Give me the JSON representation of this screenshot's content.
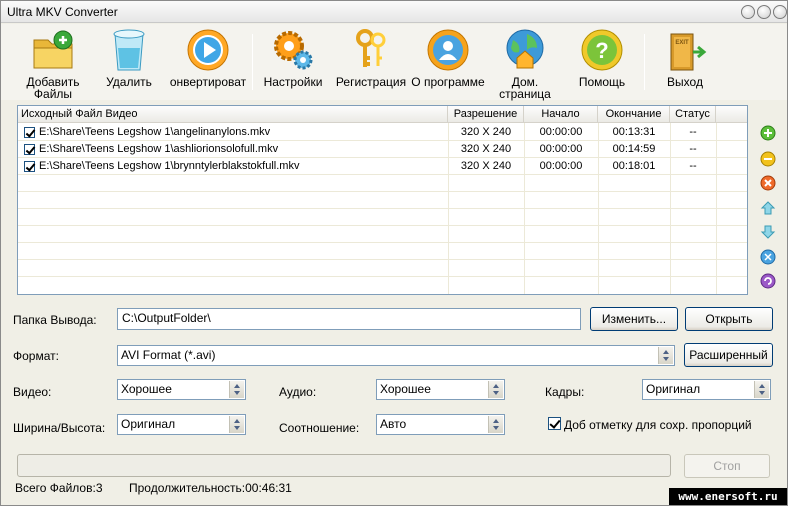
{
  "window": {
    "title": "Ultra MKV Converter"
  },
  "toolbar": {
    "add_label": "Добавить Файлы",
    "delete_label": "Удалить",
    "convert_label": "онвертироват",
    "settings_label": "Настройки",
    "register_label": "Регистрация",
    "about_label": "О программе",
    "home_label": "Дом. страница",
    "help_label": "Помощь",
    "exit_label": "Выход",
    "exit_sign": "EXIT"
  },
  "filelist": {
    "columns": [
      "Исходный Файл Видео",
      "Разрешение",
      "Начало",
      "Окончание",
      "Статус"
    ],
    "rows": [
      {
        "file": "E:\\Share\\Teens Legshow 1\\angelinanylons.mkv",
        "resolution": "320 X 240",
        "start": "00:00:00",
        "end": "00:13:31",
        "status": "--"
      },
      {
        "file": "E:\\Share\\Teens Legshow 1\\ashliorionsolofull.mkv",
        "resolution": "320 X 240",
        "start": "00:00:00",
        "end": "00:14:59",
        "status": "--"
      },
      {
        "file": "E:\\Share\\Teens Legshow 1\\brynntylerblakstokfull.mkv",
        "resolution": "320 X 240",
        "start": "00:00:00",
        "end": "00:18:01",
        "status": "--"
      }
    ]
  },
  "output": {
    "label": "Папка Вывода:",
    "value": "C:\\OutputFolder\\",
    "change_label": "Изменить...",
    "open_label": "Открыть"
  },
  "format": {
    "label": "Формат:",
    "value": "AVI Format (*.avi)",
    "advanced_label": "Расширенный"
  },
  "video": {
    "label": "Видео:",
    "value": "Хорошее"
  },
  "audio": {
    "label": "Аудио:",
    "value": "Хорошее"
  },
  "frames": {
    "label": "Кадры:",
    "value": "Оригинал"
  },
  "size": {
    "label": "Ширина/Высота:",
    "value": "Оригинал"
  },
  "ratio": {
    "label": "Соотношение:",
    "value": "Авто"
  },
  "keep_ratio": {
    "label": "Доб отметку для сохр. пропорций",
    "checked": true
  },
  "progress": {
    "fraction": 0.0,
    "stop_label": "Стоп"
  },
  "status": {
    "total": "Всего Файлов:3",
    "duration": "Продолжительность:00:46:31"
  },
  "watermark": "www.enersoft.ru",
  "colors": {
    "accent": "#003c74",
    "list_border": "#7f9db9"
  }
}
